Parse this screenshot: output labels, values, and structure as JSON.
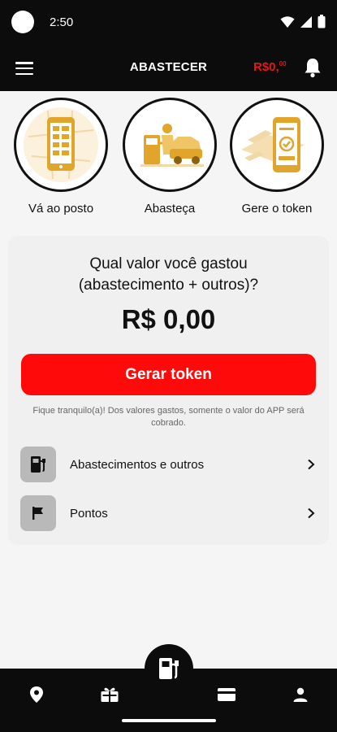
{
  "status_bar": {
    "time": "2:50"
  },
  "header": {
    "title": "ABASTECER",
    "balance_main": "R$0,",
    "balance_cents": "00",
    "menu_icon": "hamburger-menu-icon",
    "notification_icon": "bell-icon"
  },
  "steps": [
    {
      "label": "Vá ao posto",
      "icon": "phone-map-illustration"
    },
    {
      "label": "Abasteça",
      "icon": "fuel-pump-car-illustration"
    },
    {
      "label": "Gere o token",
      "icon": "phone-token-illustration"
    }
  ],
  "card": {
    "question_line1": "Qual valor você gastou",
    "question_line2": "(abastecimento + outros)?",
    "amount": "R$ 0,00",
    "button_label": "Gerar token",
    "note": "Fique tranquilo(a)! Dos valores gastos, somente o valor do APP será cobrado.",
    "rows": [
      {
        "label": "Abastecimentos e outros",
        "icon": "fuel-pump-icon"
      },
      {
        "label": "Pontos",
        "icon": "flag-icon"
      }
    ]
  },
  "bottom_nav": {
    "items": [
      "location-pin-icon",
      "gift-icon",
      "fuel-pump-icon",
      "card-icon",
      "person-icon"
    ]
  },
  "colors": {
    "accent": "#ff0a0a",
    "balance": "#e4161b",
    "illustration": "#e0a52a",
    "bar": "#0c0c0c"
  }
}
